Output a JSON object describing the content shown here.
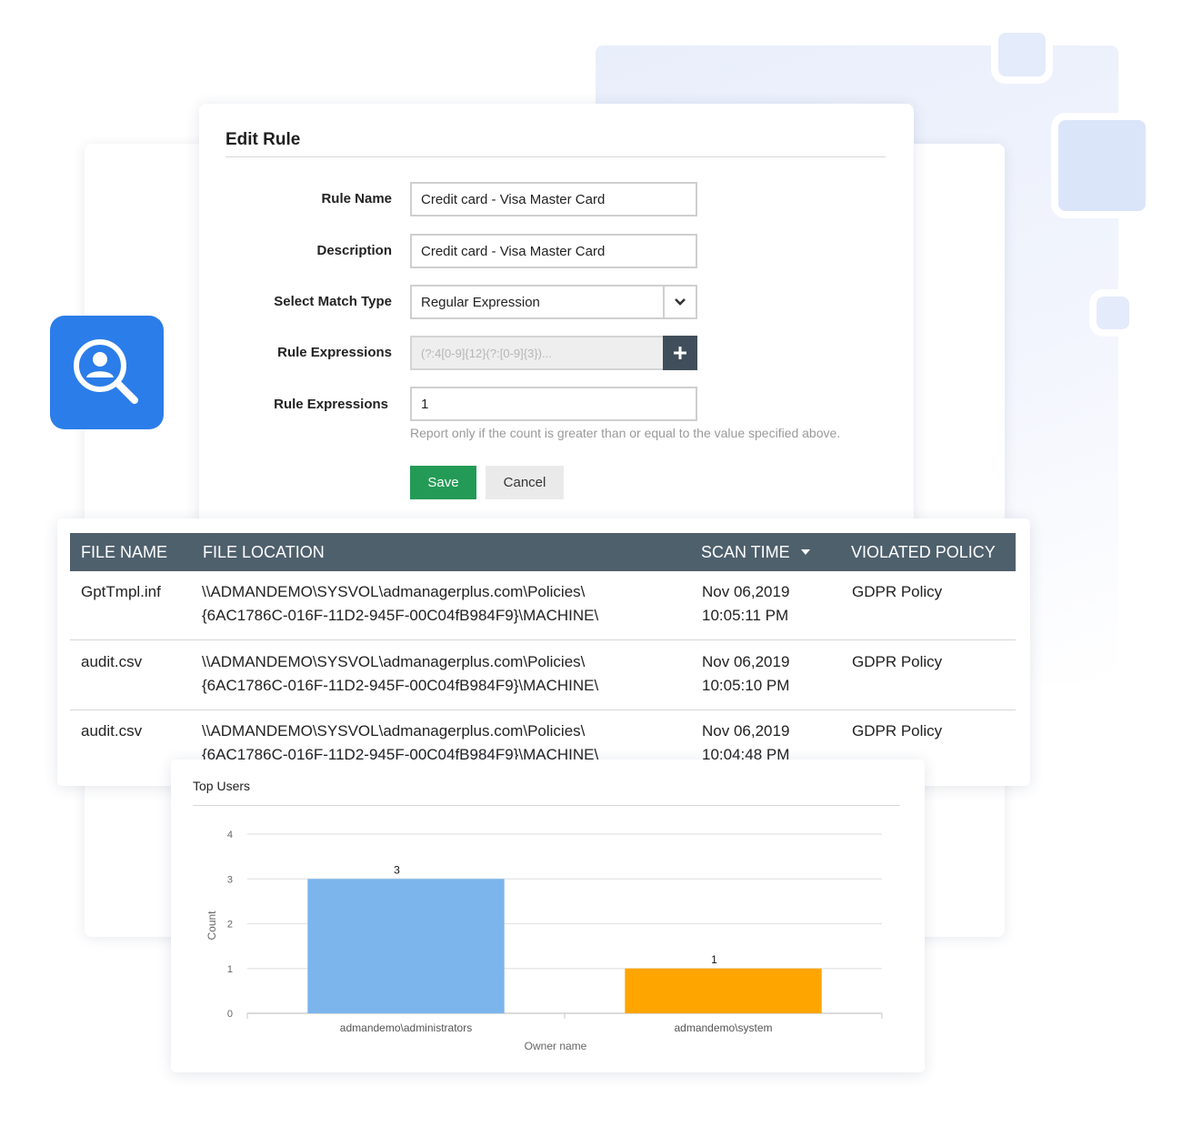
{
  "edit_rule": {
    "title": "Edit Rule",
    "fields": {
      "rule_name": {
        "label": "Rule Name",
        "value": "Credit card - Visa Master Card"
      },
      "description": {
        "label": "Description",
        "value": "Credit card - Visa Master Card"
      },
      "match_type": {
        "label": "Select Match Type",
        "value": "Regular Expression"
      },
      "rule_expressions": {
        "label": "Rule Expressions",
        "value": "(?:4[0-9]{12}(?:[0-9]{3})..."
      },
      "rule_count": {
        "label": "Rule Expressions",
        "value": "1"
      }
    },
    "hint": "Report only if the count is greater than or equal to the value specified above.",
    "save_label": "Save",
    "cancel_label": "Cancel"
  },
  "table": {
    "headers": {
      "file_name": "FILE NAME",
      "file_location": "FILE LOCATION",
      "scan_time": "SCAN TIME",
      "violated_policy": "VIOLATED POLICY"
    },
    "rows": [
      {
        "file_name": "GptTmpl.inf",
        "location_line1": "\\\\ADMANDEMO\\SYSVOL\\admanagerplus.com\\Policies\\",
        "location_line2": "{6AC1786C-016F-11D2-945F-00C04fB984F9}\\MACHINE\\",
        "date": "Nov 06,2019",
        "time": "10:05:11 PM",
        "policy": "GDPR Policy"
      },
      {
        "file_name": "audit.csv",
        "location_line1": "\\\\ADMANDEMO\\SYSVOL\\admanagerplus.com\\Policies\\",
        "location_line2": "{6AC1786C-016F-11D2-945F-00C04fB984F9}\\MACHINE\\",
        "date": "Nov 06,2019",
        "time": "10:05:10 PM",
        "policy": "GDPR Policy"
      },
      {
        "file_name": "audit.csv",
        "location_line1": "\\\\ADMANDEMO\\SYSVOL\\admanagerplus.com\\Policies\\",
        "location_line2": "{6AC1786C-016F-11D2-945F-00C04fB984F9}\\MACHINE\\",
        "date": "Nov 06,2019",
        "time": "10:04:48 PM",
        "policy": "GDPR Policy"
      }
    ]
  },
  "icons": {
    "search_user": "search-user-icon",
    "select_chevron": "chevron-down-icon",
    "add": "plus-icon",
    "sort": "sort-desc-icon"
  },
  "colors": {
    "accent_blue": "#2b7de9",
    "save_green": "#239b56",
    "table_header": "#4f606d",
    "bar_blue": "#7cb5ec",
    "bar_orange": "#ffa500"
  },
  "chart_data": {
    "type": "bar",
    "title": "Top Users",
    "categories": [
      "admandemo\\administrators",
      "admandemo\\system"
    ],
    "values": [
      3,
      1
    ],
    "colors": [
      "#7cb5ec",
      "#ffa500"
    ],
    "xlabel": "Owner name",
    "ylabel": "Count",
    "ylim": [
      0,
      4
    ],
    "yticks": [
      0,
      1,
      2,
      3,
      4
    ],
    "grid": true,
    "data_labels": true
  }
}
